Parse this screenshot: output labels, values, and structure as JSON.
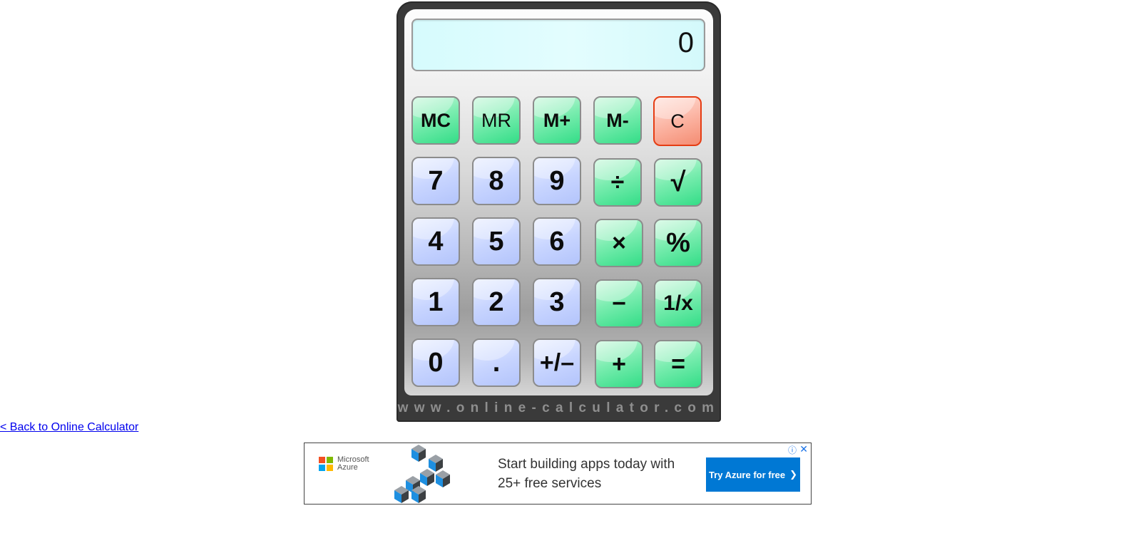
{
  "display": {
    "value": "0"
  },
  "keys": {
    "row1": [
      "MC",
      "MR",
      "M+",
      "M-",
      "C"
    ],
    "row2": [
      "7",
      "8",
      "9",
      "÷",
      "√"
    ],
    "row3": [
      "4",
      "5",
      "6",
      "×",
      "%"
    ],
    "row4": [
      "1",
      "2",
      "3",
      "−",
      "1/x"
    ],
    "row5": [
      "0",
      ".",
      "+/–",
      "+",
      "="
    ]
  },
  "brand": "www.online-calculator.com",
  "back_link": "< Back to Online Calculator",
  "ad": {
    "logo_line1": "Microsoft",
    "logo_line2": "Azure",
    "headline": "Start building apps today with 25+ free services",
    "cta": "Try Azure for free",
    "cta_icon": "chevron-right-icon",
    "info_icon": "info-icon",
    "close_icon": "close-icon",
    "colors": {
      "cta_bg": "#0078d4"
    }
  },
  "colors": {
    "green_key": "#33dd87",
    "blue_key": "#c8d5ff",
    "clear_key": "#f48c72",
    "display_bg": "#d6fbfd"
  }
}
